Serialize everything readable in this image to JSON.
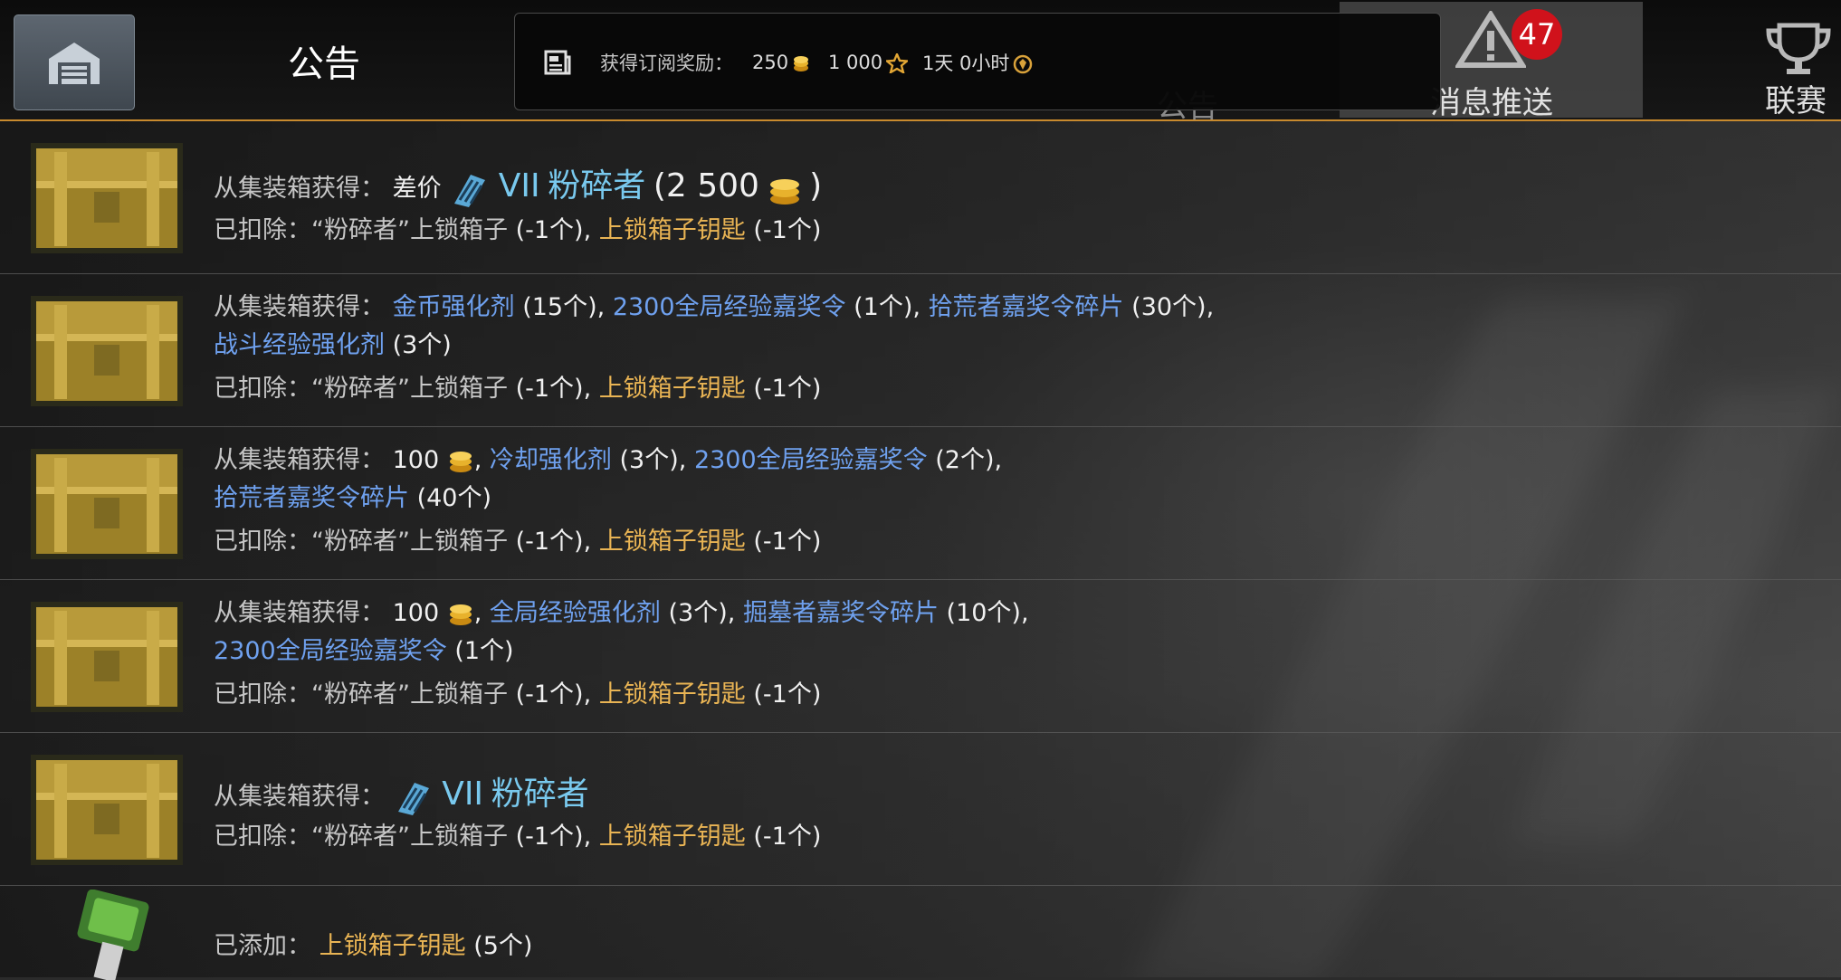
{
  "header": {
    "title": "公告",
    "hidden_tab_label": "公告",
    "news_tab": {
      "label": "消息推送",
      "badge": "47"
    },
    "league_tab": {
      "label": "联赛"
    }
  },
  "subscription": {
    "label": "获得订阅奖励：",
    "gold": "250",
    "stars": "1 000",
    "time": "1天 0小时"
  },
  "rows": [
    {
      "icon": "gold-crate-icon",
      "received_label": "从集装箱获得：",
      "compensation": "差价",
      "tank_tier": "VII",
      "tank_name": "粉碎者",
      "amount_open": "(2 500",
      "amount_close": ")",
      "removed_label": "已扣除：",
      "removed_item": "“粉碎者”上锁箱子",
      "removed_count": "(-1个)",
      "separator": ",",
      "removed_key": "上锁箱子钥匙",
      "removed_key_count": "(-1个)"
    },
    {
      "icon": "gold-crate-icon",
      "received_label": "从集装箱获得：",
      "items": [
        {
          "name": "金币强化剂",
          "count": "(15个)",
          "sep": ","
        },
        {
          "name": "2300全局经验嘉奖令",
          "count": "(1个)",
          "sep": ","
        },
        {
          "name": "拾荒者嘉奖令碎片",
          "count": "(30个)",
          "sep": ","
        },
        {
          "name": "战斗经验强化剂",
          "count": "(3个)",
          "sep": ""
        }
      ],
      "removed_label": "已扣除：",
      "removed_item": "“粉碎者”上锁箱子",
      "removed_count": "(-1个)",
      "separator": ",",
      "removed_key": "上锁箱子钥匙",
      "removed_key_count": "(-1个)"
    },
    {
      "icon": "gold-crate-icon",
      "received_label": "从集装箱获得：",
      "gold": "100",
      "items": [
        {
          "name": "冷却强化剂",
          "count": "(3个)",
          "sep": ","
        },
        {
          "name": "2300全局经验嘉奖令",
          "count": "(2个)",
          "sep": ","
        },
        {
          "name": "拾荒者嘉奖令碎片",
          "count": "(40个)",
          "sep": ""
        }
      ],
      "removed_label": "已扣除：",
      "removed_item": "“粉碎者”上锁箱子",
      "removed_count": "(-1个)",
      "separator": ",",
      "removed_key": "上锁箱子钥匙",
      "removed_key_count": "(-1个)"
    },
    {
      "icon": "gold-crate-icon",
      "received_label": "从集装箱获得：",
      "gold": "100",
      "items": [
        {
          "name": "全局经验强化剂",
          "count": "(3个)",
          "sep": ","
        },
        {
          "name": "掘墓者嘉奖令碎片",
          "count": "(10个)",
          "sep": ","
        },
        {
          "name": "2300全局经验嘉奖令",
          "count": "(1个)",
          "sep": ""
        }
      ],
      "removed_label": "已扣除：",
      "removed_item": "“粉碎者”上锁箱子",
      "removed_count": "(-1个)",
      "separator": ",",
      "removed_key": "上锁箱子钥匙",
      "removed_key_count": "(-1个)"
    },
    {
      "icon": "gold-crate-icon",
      "received_label": "从集装箱获得：",
      "tank_tier": "VII",
      "tank_name": "粉碎者",
      "removed_label": "已扣除：",
      "removed_item": "“粉碎者”上锁箱子",
      "removed_count": "(-1个)",
      "separator": ",",
      "removed_key": "上锁箱子钥匙",
      "removed_key_count": "(-1个)"
    },
    {
      "icon": "green-key-icon",
      "added_label": "已添加：",
      "added_item": "上锁箱子钥匙",
      "added_count": "(5个)"
    }
  ],
  "colors": {
    "item_blue": "#6fa1ef",
    "key_gold": "#e9b454",
    "tank_cyan": "#79c9ee",
    "accent_line": "#c88a2e",
    "badge_red": "#d0121b"
  }
}
